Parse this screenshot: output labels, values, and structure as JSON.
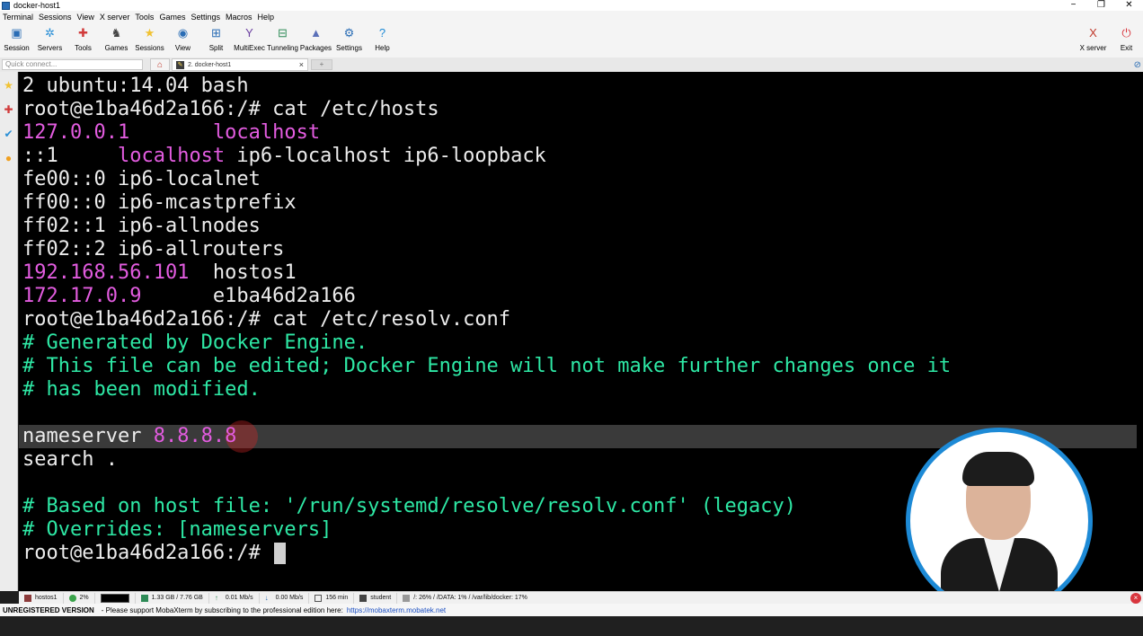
{
  "window": {
    "title": "docker-host1"
  },
  "menu": [
    "Terminal",
    "Sessions",
    "View",
    "X server",
    "Tools",
    "Games",
    "Settings",
    "Macros",
    "Help"
  ],
  "toolbar": {
    "left": [
      {
        "label": "Session",
        "icon": "session-icon",
        "glyph": "▣",
        "color": "#2a6db5"
      },
      {
        "label": "Servers",
        "icon": "servers-icon",
        "glyph": "✲",
        "color": "#2a8fd6"
      },
      {
        "label": "Tools",
        "icon": "tools-icon",
        "glyph": "✚",
        "color": "#d13b3b"
      },
      {
        "label": "Games",
        "icon": "games-icon",
        "glyph": "♞",
        "color": "#444444"
      },
      {
        "label": "Sessions",
        "icon": "star-icon",
        "glyph": "★",
        "color": "#f1c232"
      },
      {
        "label": "View",
        "icon": "view-icon",
        "glyph": "◉",
        "color": "#2a6db5"
      },
      {
        "label": "Split",
        "icon": "split-icon",
        "glyph": "⊞",
        "color": "#2a6db5"
      },
      {
        "label": "MultiExec",
        "icon": "multiexec-icon",
        "glyph": "Y",
        "color": "#6b3fa0"
      },
      {
        "label": "Tunneling",
        "icon": "tunneling-icon",
        "glyph": "⊟",
        "color": "#2e8b57"
      },
      {
        "label": "Packages",
        "icon": "packages-icon",
        "glyph": "▲",
        "color": "#5a6fb8"
      },
      {
        "label": "Settings",
        "icon": "gear-icon",
        "glyph": "⚙",
        "color": "#2a6db5"
      },
      {
        "label": "Help",
        "icon": "help-icon",
        "glyph": "?",
        "color": "#1d8ad6"
      }
    ],
    "right": [
      {
        "label": "X server",
        "icon": "x-server-icon",
        "glyph": "X",
        "color": "#c0392b"
      },
      {
        "label": "Exit",
        "icon": "power-icon",
        "glyph": "⏻",
        "color": "#d9363e"
      }
    ]
  },
  "tabs": {
    "quick_connect_placeholder": "Quick connect...",
    "active_tab": "2. docker-host1"
  },
  "terminal": {
    "lines": [
      [
        {
          "t": "2 ubuntu:14.04 bash",
          "c": "w"
        }
      ],
      [
        {
          "t": "root@e1ba46d2a166:/# cat /etc/hosts",
          "c": "w"
        }
      ],
      [
        {
          "t": "127.0.0.1",
          "c": "m"
        },
        {
          "t": "       ",
          "c": "w"
        },
        {
          "t": "localhost",
          "c": "m"
        }
      ],
      [
        {
          "t": "::1     ",
          "c": "w"
        },
        {
          "t": "localhost",
          "c": "m"
        },
        {
          "t": " ip6-localhost ip6-loopback",
          "c": "w"
        }
      ],
      [
        {
          "t": "fe00::0 ip6-localnet",
          "c": "w"
        }
      ],
      [
        {
          "t": "ff00::0 ip6-mcastprefix",
          "c": "w"
        }
      ],
      [
        {
          "t": "ff02::1 ip6-allnodes",
          "c": "w"
        }
      ],
      [
        {
          "t": "ff02::2 ip6-allrouters",
          "c": "w"
        }
      ],
      [
        {
          "t": "192.168.56.101",
          "c": "m"
        },
        {
          "t": "  hostos1",
          "c": "w"
        }
      ],
      [
        {
          "t": "172.17.0.9",
          "c": "m"
        },
        {
          "t": "      e1ba46d2a166",
          "c": "w"
        }
      ],
      [
        {
          "t": "root@e1ba46d2a166:/# cat /etc/resolv.conf",
          "c": "w"
        }
      ],
      [
        {
          "t": "# Generated by Docker Engine.",
          "c": "g"
        }
      ],
      [
        {
          "t": "# This file can be edited; Docker Engine will not make further changes once it",
          "c": "g"
        }
      ],
      [
        {
          "t": "# has been modified.",
          "c": "g"
        }
      ],
      [
        {
          "t": "",
          "c": "w"
        }
      ],
      [
        {
          "t": "nameserver ",
          "c": "w"
        },
        {
          "t": "8.8.8.8",
          "c": "m"
        }
      ],
      [
        {
          "t": "search .",
          "c": "w"
        }
      ],
      [
        {
          "t": "",
          "c": "w"
        }
      ],
      [
        {
          "t": "# Based on host file: '/run/systemd/resolve/resolv.conf' (legacy)",
          "c": "g"
        }
      ],
      [
        {
          "t": "# Overrides: [nameservers]",
          "c": "g"
        }
      ],
      [
        {
          "t": "root@e1ba46d2a166:/# ",
          "c": "w"
        }
      ]
    ]
  },
  "status": {
    "host": "hostos1",
    "cpu": "2%",
    "memory": "1.33 GB / 7.76 GB",
    "upload": "0.01 Mb/s",
    "download": "0.00 Mb/s",
    "uptime": "156 min",
    "user": "student",
    "disks": [
      "/: 26%",
      "/DATA: 1%",
      "/var/lib/docker: 17%"
    ]
  },
  "notice": {
    "unregistered": "UNREGISTERED VERSION",
    "message": "-  Please support MobaXterm by subscribing to the professional edition here:",
    "link": "https://mobaxterm.mobatek.net"
  },
  "colors": {
    "magenta": "#e35ce0",
    "green": "#2ee8a5",
    "white": "#ececec",
    "webcam_ring": "#1d8ad6"
  }
}
